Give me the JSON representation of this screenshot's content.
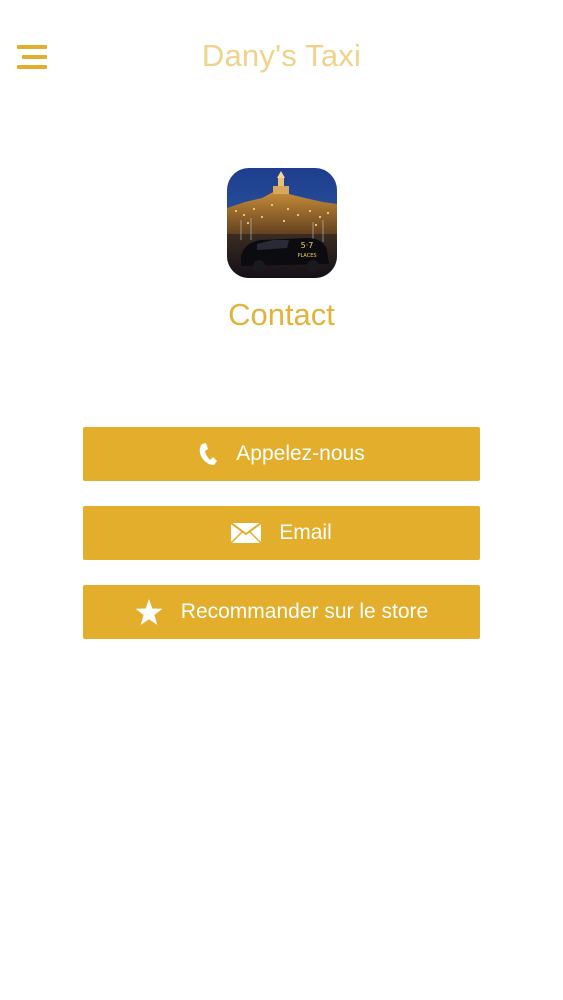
{
  "navbar": {
    "title": "Dany's Taxi",
    "menu_icon": "hamburger-menu-icon"
  },
  "app_icon": {
    "name": "app-logo",
    "badge_text": "5·7 PLACES"
  },
  "page": {
    "title": "Contact"
  },
  "actions": [
    {
      "label": "Appelez-nous",
      "icon": "phone-icon"
    },
    {
      "label": "Email",
      "icon": "envelope-icon"
    },
    {
      "label": "Recommander sur le store",
      "icon": "star-icon"
    }
  ],
  "colors": {
    "accent": "#e2ae2b",
    "title_accent": "#e2b33b",
    "nav_title": "#f0d28a",
    "button_text": "#ffffff",
    "background": "#ffffff"
  }
}
